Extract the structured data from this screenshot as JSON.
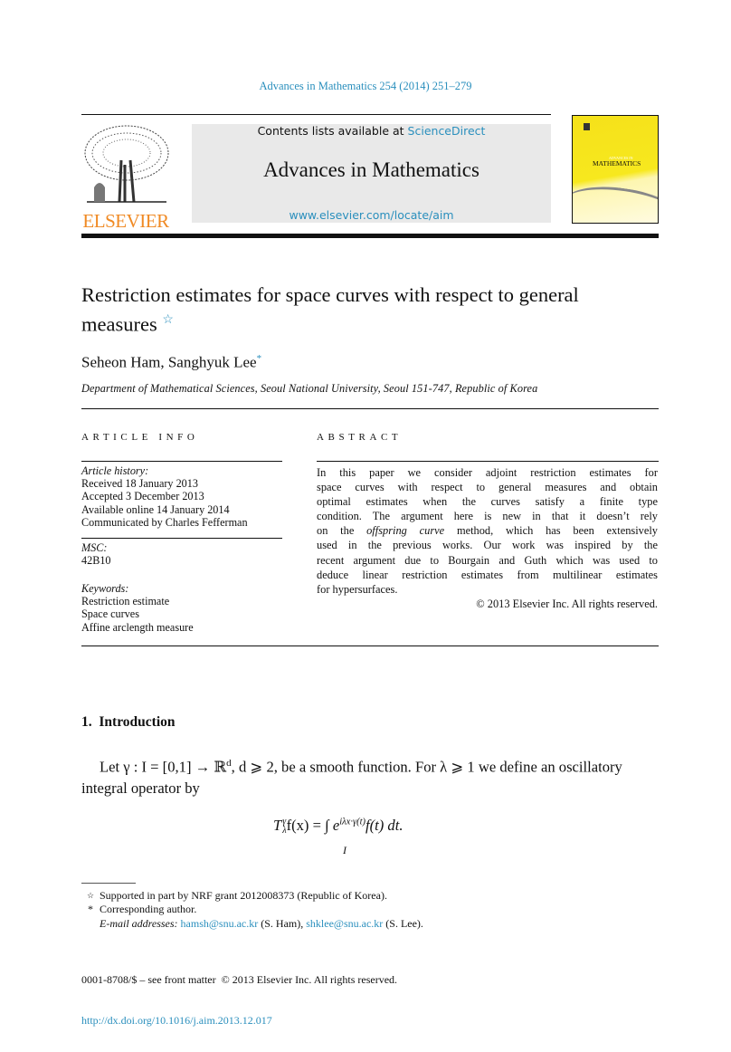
{
  "journal_ref": "Advances in Mathematics 254 (2014) 251–279",
  "masthead": {
    "contents_prefix": "Contents lists available at ",
    "sciencedirect": "ScienceDirect",
    "journal_title": "Advances in Mathematics",
    "url": "www.elsevier.com/locate/aim",
    "publisher_logo": "ELSEVIER",
    "cover_title": "MATHEMATICS",
    "cover_small": "ADVANCES IN"
  },
  "colors": {
    "link": "#2a8fbd",
    "elsevier_orange": "#f08a24",
    "cover_yellow": "#f5e11a"
  },
  "article": {
    "title_line1": "Restriction estimates for space curves with respect to general",
    "title_line2": "measures",
    "title_star": "☆",
    "authors": "Seheon Ham, Sanghyuk Lee",
    "author_star": "*",
    "affiliation": "Department of Mathematical Sciences, Seoul National University, Seoul 151-747, Republic of Korea"
  },
  "article_info": {
    "heading": "ARTICLE INFO",
    "history_label": "Article history:",
    "history": [
      "Received 18 January 2013",
      "Accepted 3 December 2013",
      "Available online 14 January 2014",
      "Communicated by Charles Fefferman"
    ],
    "msc_label": "MSC:",
    "msc": "42B10",
    "keywords_label": "Keywords:",
    "keywords": [
      "Restriction estimate",
      "Space curves",
      "Affine arclength measure"
    ]
  },
  "abstract": {
    "heading": "ABSTRACT",
    "lines": [
      "In this paper we consider adjoint restriction estimates for",
      "space curves with respect to general measures and obtain",
      "optimal estimates when the curves satisfy a finite type",
      "condition. The argument here is new in that it doesn’t rely",
      "on the |offspring curve| method, which has been extensively",
      "used in the previous works. Our work was inspired by the",
      "recent argument due to Bourgain and Guth which was used to",
      "deduce linear restriction estimates from multilinear estimates"
    ],
    "l3_a": "on the ",
    "l3_em": "offspring curve",
    "l3_b": " method, which has been extensively",
    "last_line": "for hypersurfaces.",
    "copyright": "© 2013 Elsevier Inc. All rights reserved."
  },
  "section": {
    "heading": "1.  Introduction",
    "para_line1": "Let γ : I = [0,1] → ℝ",
    "para_sup": "d",
    "para_line1b": ", d ⩾ 2, be a smooth function. For λ ⩾ 1 we define an oscillatory",
    "para_line2": "integral operator by",
    "equation": "T",
    "eq_sup": "γ",
    "eq_sub": "λ",
    "eq_mid": "f(x) = ∫",
    "eq_lower": "I",
    "eq_e": "e",
    "eq_exp": "iλx·γ(t)",
    "eq_end": "f(t) dt."
  },
  "footnotes": {
    "fn1_mark": "☆",
    "fn1": "Supported in part by NRF grant 2012008373 (Republic of Korea).",
    "fn2_mark": "*",
    "fn2": "Corresponding author.",
    "email_label": "E-mail addresses:",
    "email1": "hamsh@snu.ac.kr",
    "email1_who": " (S. Ham), ",
    "email2": "shklee@snu.ac.kr",
    "email2_who": " (S. Lee)."
  },
  "front_matter": {
    "issn": "0001-8708/$ – see front matter  © 2013 Elsevier Inc. All rights reserved.",
    "doi": "http://dx.doi.org/10.1016/j.aim.2013.12.017"
  }
}
